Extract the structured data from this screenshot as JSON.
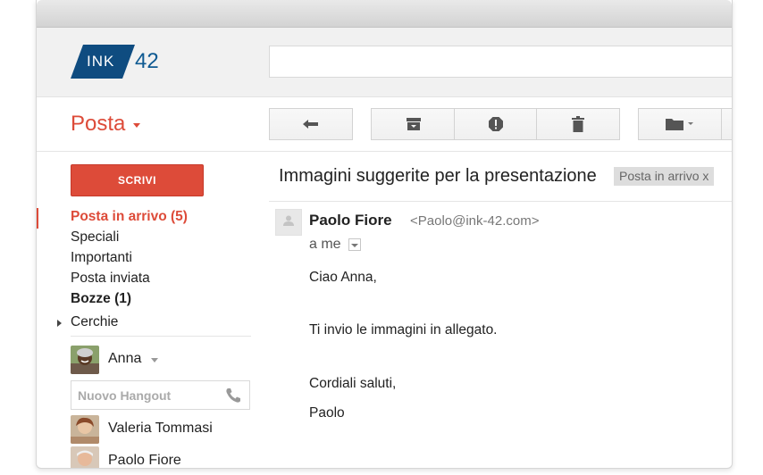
{
  "app": {
    "logo_text": "INK",
    "logo_number": "42",
    "brand_color": "#0f4c80",
    "accent_color": "#dd4b39"
  },
  "header": {
    "search_value": ""
  },
  "toolbar": {
    "title": "Posta",
    "buttons": [
      "reply-icon",
      "archive-icon",
      "spam-icon",
      "delete-icon",
      "folder-icon"
    ]
  },
  "sidebar": {
    "compose_label": "SCRIVI",
    "items": [
      {
        "label": "Posta in arrivo (5)",
        "state": "active"
      },
      {
        "label": "Speciali"
      },
      {
        "label": "Importanti"
      },
      {
        "label": "Posta inviata"
      },
      {
        "label": "Bozze (1)",
        "state": "bold"
      },
      {
        "label": "Cerchie"
      }
    ],
    "current_user": "Anna",
    "hangout_placeholder": "Nuovo Hangout",
    "contacts": [
      "Valeria Tommasi",
      "Paolo Fiore"
    ]
  },
  "message": {
    "subject": "Immagini suggerite per la presentazione",
    "label": "Posta in arrivo x",
    "sender_name": "Paolo Fiore",
    "sender_email": "<Paolo@ink-42.com>",
    "recipient": "a me",
    "body": [
      "Ciao Anna,",
      "Ti invio le immagini in allegato.",
      "Cordiali saluti,",
      "Paolo"
    ]
  }
}
